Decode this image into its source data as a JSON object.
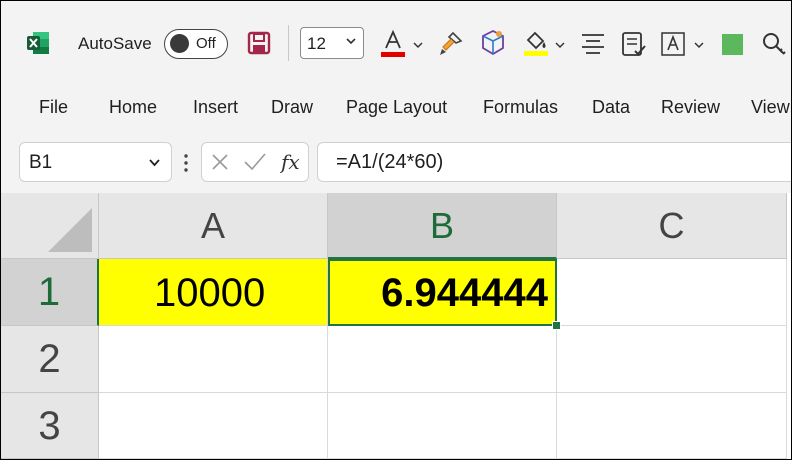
{
  "toolbar": {
    "autosave_label": "AutoSave",
    "autosave_state": "Off",
    "font_size": "12",
    "icons": [
      "excel-logo-icon",
      "save-icon",
      "font-color-icon",
      "format-painter-icon",
      "3d-model-icon",
      "fill-color-icon",
      "align-icon",
      "checklist-icon",
      "text-box-icon",
      "green-square-icon",
      "search-icon"
    ],
    "font_color": "#e00000",
    "fill_color": "#ffff00",
    "accent": "#217346"
  },
  "ribbon": {
    "tabs": [
      "File",
      "Home",
      "Insert",
      "Draw",
      "Page Layout",
      "Formulas",
      "Data",
      "Review",
      "View"
    ]
  },
  "formula_bar": {
    "name_box": "B1",
    "formula": "=A1/(24*60)"
  },
  "sheet": {
    "columns": [
      "A",
      "B",
      "C"
    ],
    "rows": [
      "1",
      "2",
      "3"
    ],
    "selected_cell": "B1",
    "cells": {
      "A1": "10000",
      "B1": "6.944444"
    }
  }
}
